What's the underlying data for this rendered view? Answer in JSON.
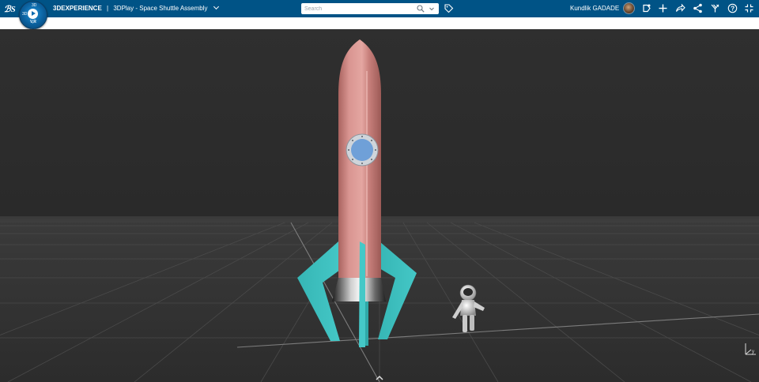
{
  "topbar": {
    "brand": "3DEXPERIENCE",
    "separator": "|",
    "app_name": "3DPlay - Space Shuttle Assembly",
    "search_placeholder": "Search",
    "user_name": "Kundlik GADADE",
    "compass_label": "V,R",
    "compass_north": "3D",
    "compass_west": "3D"
  },
  "icons": {
    "logo": "ds-logo-icon",
    "compass": "compass-icon",
    "search": "search-icon",
    "search_dropdown": "chevron-down-icon",
    "tag": "tag-icon",
    "notifications": "notification-icon",
    "add": "plus-icon",
    "share": "share-icon",
    "collaborate": "network-icon",
    "tools": "tools-icon",
    "help": "help-icon",
    "fullscreen": "fullscreen-icon",
    "axis": "axis-triad-icon",
    "expand": "chevron-up-icon"
  },
  "colors": {
    "topbar": "#005386",
    "background": "#2b2b2b",
    "rocket_body": "#d08a86",
    "fins": "#3ebebd",
    "porthole": "#6fa0d8"
  }
}
